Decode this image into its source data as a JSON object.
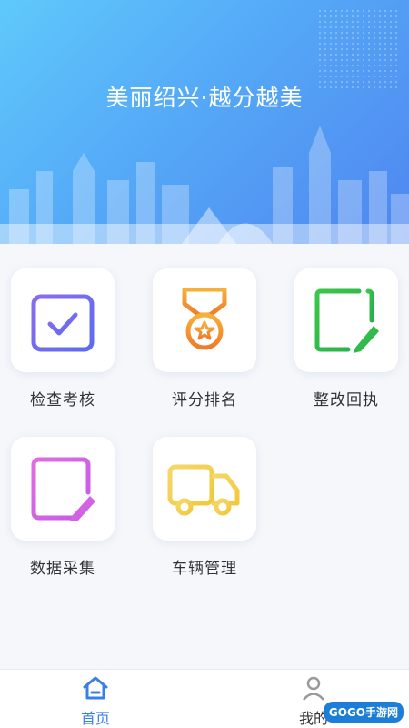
{
  "hero": {
    "title": "美丽绍兴·越分越美"
  },
  "menu": [
    {
      "label": "检查考核"
    },
    {
      "label": "评分排名"
    },
    {
      "label": "整改回执"
    },
    {
      "label": "数据采集"
    },
    {
      "label": "车辆管理"
    }
  ],
  "tabbar": {
    "home_label": "首页",
    "mine_label": "我的"
  },
  "watermark": "GOGO手游网",
  "colors": {
    "hero_start": "#5fc9fb",
    "hero_end": "#4f86f0",
    "tab_active": "#3b7fe6"
  }
}
